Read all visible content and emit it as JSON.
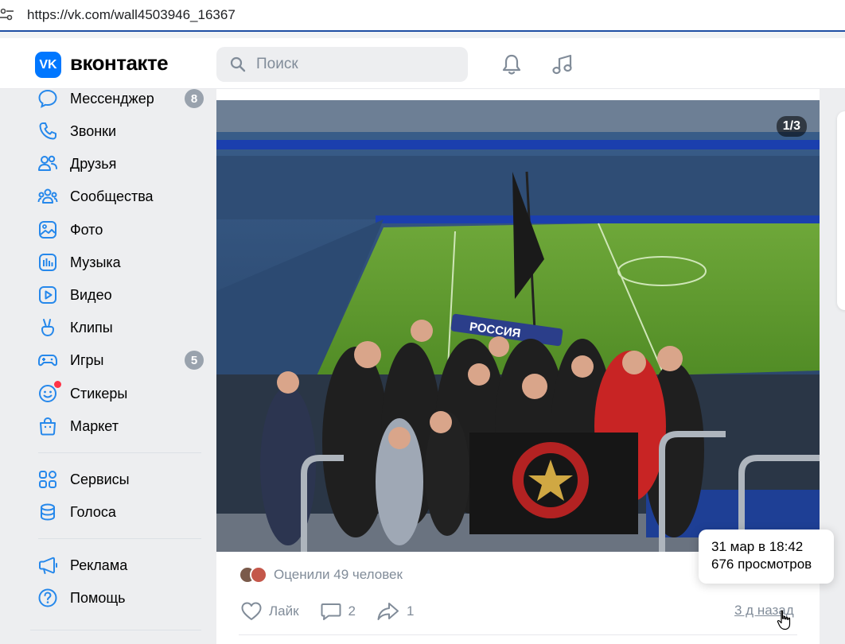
{
  "browser": {
    "url": "https://vk.com/wall4503946_16367"
  },
  "header": {
    "logo_mark": "VK",
    "logo_text": "вконтакте",
    "search_placeholder": "Поиск",
    "icons": [
      "bell-icon",
      "music-icon"
    ]
  },
  "sidebar": {
    "items": [
      {
        "label": "Мессенджер",
        "icon": "messenger-icon",
        "badge": "8"
      },
      {
        "label": "Звонки",
        "icon": "phone-icon"
      },
      {
        "label": "Друзья",
        "icon": "friends-icon"
      },
      {
        "label": "Сообщества",
        "icon": "communities-icon"
      },
      {
        "label": "Фото",
        "icon": "photo-icon"
      },
      {
        "label": "Музыка",
        "icon": "music-icon"
      },
      {
        "label": "Видео",
        "icon": "video-icon"
      },
      {
        "label": "Клипы",
        "icon": "clips-icon"
      },
      {
        "label": "Игры",
        "icon": "games-icon",
        "badge": "5"
      },
      {
        "label": "Стикеры",
        "icon": "stickers-icon"
      },
      {
        "label": "Маркет",
        "icon": "market-icon"
      },
      {
        "label": "Сервисы",
        "icon": "services-icon"
      },
      {
        "label": "Голоса",
        "icon": "votes-icon"
      },
      {
        "label": "Реклама",
        "icon": "ads-icon"
      },
      {
        "label": "Помощь",
        "icon": "help-icon"
      }
    ]
  },
  "post": {
    "photo_counter": "1/3",
    "photo_scarf_text": "РОССИЯ",
    "liked_text": "Оценили 49 человек",
    "like_label": "Лайк",
    "comments_count": "2",
    "shares_count": "1",
    "time_ago": "3 д назад"
  },
  "tooltip": {
    "date": "31 мар в 18:42",
    "views": "676 просмотров"
  },
  "colors": {
    "accent": "#0077ff",
    "muted": "#818c99",
    "icon": "#2688eb",
    "badge": "#99a2ad"
  }
}
